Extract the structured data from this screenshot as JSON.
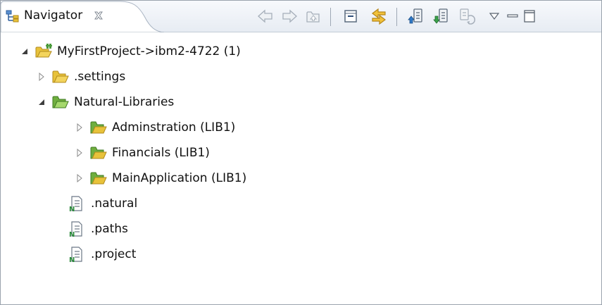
{
  "view": {
    "tab_title": "Navigator",
    "tab_icon": "navigator-icon",
    "close_icon": "close-icon"
  },
  "toolbar": [
    {
      "name": "back-button",
      "icon": "back-arrow-icon"
    },
    {
      "name": "forward-button",
      "icon": "forward-arrow-icon"
    },
    {
      "name": "up-button",
      "icon": "up-folder-icon"
    },
    {
      "name": "collapse-all-button",
      "icon": "collapse-all-icon"
    },
    {
      "name": "link-with-editor-button",
      "icon": "link-with-editor-icon"
    },
    {
      "name": "upload-button",
      "icon": "upload-icon"
    },
    {
      "name": "download-button",
      "icon": "download-icon"
    },
    {
      "name": "synchronize-button",
      "icon": "synchronize-icon"
    },
    {
      "name": "view-menu-button",
      "icon": "view-menu-icon"
    },
    {
      "name": "minimize-button",
      "icon": "minimize-icon"
    },
    {
      "name": "maximize-button",
      "icon": "maximize-icon"
    }
  ],
  "tree": {
    "project": {
      "label": "MyFirstProject->ibm2-4722 (1)",
      "expanded": true,
      "icon": "project-icon"
    },
    "settings": {
      "label": ".settings",
      "expanded": false,
      "icon": "folder-icon"
    },
    "natural_libraries": {
      "label": "Natural-Libraries",
      "expanded": true,
      "icon": "folder-open-icon"
    },
    "adminstration": {
      "label": "Adminstration (LIB1)",
      "expanded": false,
      "icon": "folder-open-icon"
    },
    "financials": {
      "label": "Financials (LIB1)",
      "expanded": false,
      "icon": "folder-open-icon"
    },
    "mainapplication": {
      "label": "MainApplication (LIB1)",
      "expanded": false,
      "icon": "folder-open-icon"
    },
    "natural_file": {
      "label": ".natural",
      "icon": "natural-file-icon"
    },
    "paths_file": {
      "label": ".paths",
      "icon": "natural-file-icon"
    },
    "project_file": {
      "label": ".project",
      "icon": "natural-file-icon"
    }
  },
  "colors": {
    "folder": "#e8c23a",
    "folder_edge": "#b18a1c",
    "library_folder": "#8fc45a",
    "toolbar_icon": "#9aa6b5"
  }
}
